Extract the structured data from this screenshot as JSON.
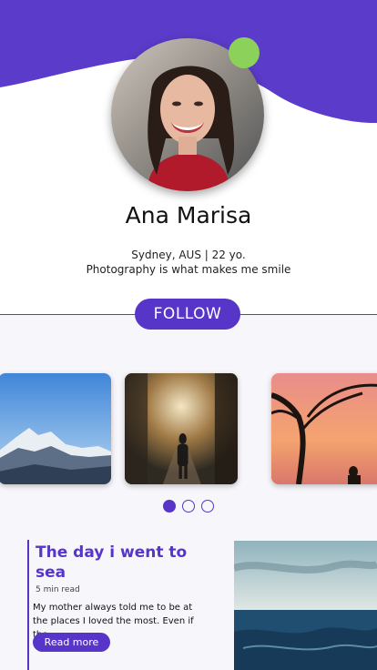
{
  "profile": {
    "name": "Ana Marisa",
    "location_age": "Sydney, AUS | 22 yo.",
    "bio": "Photography is what makes me smile",
    "online_status_color": "#8bd15a"
  },
  "follow_button": {
    "label": "FOLLOW"
  },
  "gallery": {
    "photos": [
      {
        "subject": "snowy mountain range"
      },
      {
        "subject": "person in misty forest"
      },
      {
        "subject": "tree silhouette at sunset"
      }
    ],
    "pagination": {
      "active_index": 0,
      "count": 3
    }
  },
  "post": {
    "title": "The day i went to sea",
    "read_time": "5 min read",
    "excerpt": "My mother always told me to be at the places I loved the most. Even if the...",
    "cta_label": "Read more",
    "image_subject": "ocean waves under cloudy sky"
  },
  "colors": {
    "accent": "#5635c8",
    "wave": "#5b3bc9",
    "background": "#f7f6fb"
  }
}
